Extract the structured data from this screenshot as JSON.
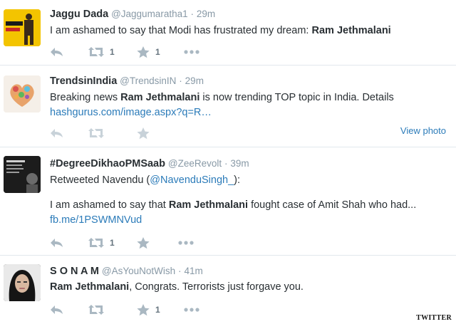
{
  "tweets": [
    {
      "fullname": "Jaggu Dada",
      "handle": "@Jaggumaratha1",
      "sep": "·",
      "time": "29m",
      "text_before": "I am ashamed to say that Modi has frustrated my dream: ",
      "text_bold": "Ram Jethmalani",
      "text_after": "",
      "retweet_count": "1",
      "favorite_count": "1",
      "avatar_text": "MAIN KHWAB KI"
    },
    {
      "fullname": "TrendsinIndia",
      "handle": "@TrendsinIN",
      "sep": "·",
      "time": "29m",
      "text_before": "Breaking news ",
      "text_bold": "Ram Jethmalani",
      "text_after": " is now trending TOP topic in India. Details",
      "link": "hashgurus.com/image.aspx?q=R…",
      "view_photo": "View photo",
      "retweet_count": "",
      "favorite_count": ""
    },
    {
      "fullname": "#DegreeDikhaoPMSaab",
      "handle": "@ZeeRevolt",
      "sep": "·",
      "time": "39m",
      "retweeted_prefix": "Retweeted Navendu (",
      "retweeted_handle": "@NavenduSingh_",
      "retweeted_suffix": "):",
      "text_before": "I am ashamed to say that ",
      "text_bold": "Ram Jethmalani",
      "text_after": " fought case of Amit Shah who had... ",
      "link": "fb.me/1PSWMNVud",
      "retweet_count": "1",
      "favorite_count": ""
    },
    {
      "fullname": "S O N A M",
      "handle": "@AsYouNotWish",
      "sep": "·",
      "time": "41m",
      "text_before": "",
      "text_bold": "Ram Jethmalani",
      "text_after": ", Congrats. Terrorists just forgave you.",
      "retweet_count": "",
      "favorite_count": "1"
    }
  ],
  "credit": "TWITTER",
  "colors": {
    "link": "#2b7bb9",
    "muted": "#8899a6",
    "icon": "#aab8c2",
    "divider": "#e1e8ed"
  },
  "icons": [
    "reply-icon",
    "retweet-icon",
    "favorite-star-icon",
    "more-dots-icon"
  ]
}
